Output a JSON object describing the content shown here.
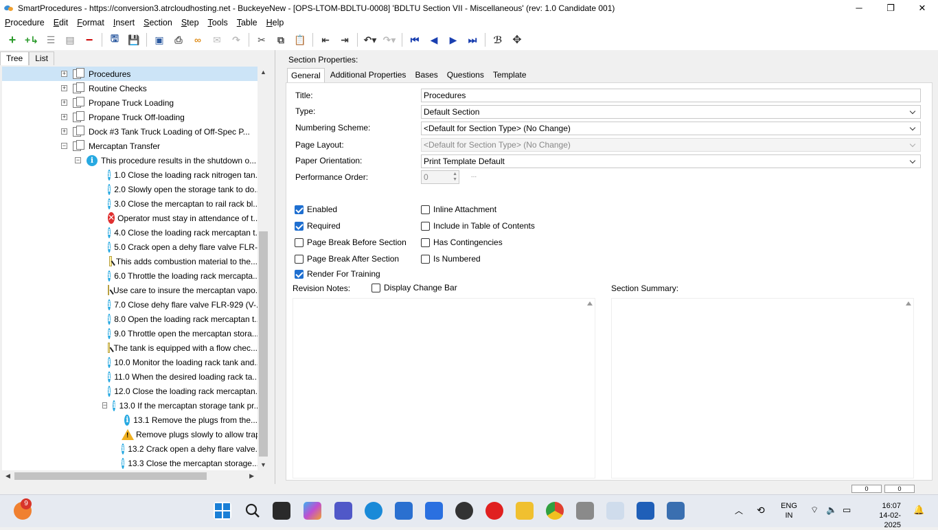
{
  "window": {
    "title": "SmartProcedures - https://conversion3.atrcloudhosting.net - BuckeyeNew - [OPS-LTOM-BDLTU-0008] 'BDLTU Section VII - Miscellaneous' (rev: 1.0 Candidate 001)",
    "minimize": "─",
    "maximize": "❐",
    "close": "✕"
  },
  "menu": [
    "Procedure",
    "Edit",
    "Format",
    "Insert",
    "Section",
    "Step",
    "Tools",
    "Table",
    "Help"
  ],
  "left_tabs": [
    "Tree",
    "List"
  ],
  "tree": [
    {
      "label": "Procedures",
      "type": "doc",
      "expander": "+",
      "level": 0,
      "selected": true
    },
    {
      "label": "Routine Checks",
      "type": "doc",
      "expander": "+",
      "level": 0
    },
    {
      "label": "Propane Truck Loading",
      "type": "doc",
      "expander": "+",
      "level": 0
    },
    {
      "label": "Propane Truck Off-loading",
      "type": "doc",
      "expander": "+",
      "level": 0
    },
    {
      "label": "Dock #3 Tank Truck Loading of Off-Spec P...",
      "type": "doc",
      "expander": "+",
      "level": 0
    },
    {
      "label": "Mercaptan Transfer",
      "type": "doc",
      "expander": "−",
      "level": 0
    },
    {
      "label": "This procedure results in the shutdown o...",
      "type": "info",
      "expander": "−",
      "level": 1
    },
    {
      "label": "1.0 Close the loading rack nitrogen tan...",
      "type": "info",
      "level": 2
    },
    {
      "label": "2.0 Slowly open the storage tank to do...",
      "type": "info",
      "level": 2
    },
    {
      "label": "3.0 Close the mercaptan to rail rack bl...",
      "type": "info",
      "level": 2
    },
    {
      "label": "Operator must stay in attendance of t...",
      "type": "error",
      "level": 2
    },
    {
      "label": "4.0 Close the loading rack mercaptan t...",
      "type": "info",
      "level": 2
    },
    {
      "label": "5.0 Crack open a dehy flare valve FLR-...",
      "type": "info",
      "level": 2
    },
    {
      "label": "This adds combustion material to the...",
      "type": "note",
      "level": 2
    },
    {
      "label": "6.0 Throttle the loading rack mercapta...",
      "type": "info",
      "level": 2
    },
    {
      "label": "Use care to insure the mercaptan vapo...",
      "type": "note",
      "level": 2
    },
    {
      "label": "7.0 Close dehy flare valve FLR-929 (V-...",
      "type": "info",
      "level": 2
    },
    {
      "label": "8.0 Open the loading rack mercaptan t...",
      "type": "info",
      "level": 2
    },
    {
      "label": "9.0 Throttle open the mercaptan stora...",
      "type": "info",
      "level": 2
    },
    {
      "label": "The tank is equipped with a flow chec...",
      "type": "note",
      "level": 2
    },
    {
      "label": "10.0 Monitor the loading rack tank and...",
      "type": "info",
      "level": 2
    },
    {
      "label": "11.0 When the desired loading rack ta...",
      "type": "info",
      "level": 2
    },
    {
      "label": "12.0 Close the loading rack mercaptan...",
      "type": "info",
      "level": 2
    },
    {
      "label": "13.0 If the mercaptan storage tank pr...",
      "type": "info",
      "expander": "−",
      "level": 2
    },
    {
      "label": "13.1 Remove the plugs from the...",
      "type": "info",
      "level": 3
    },
    {
      "label": "Remove plugs slowly to allow trap...",
      "type": "warn",
      "level": 3
    },
    {
      "label": "13.2 Crack open a dehy flare valve...",
      "type": "info",
      "level": 3
    },
    {
      "label": "13.3 Close the mercaptan storage...",
      "type": "info",
      "level": 3
    }
  ],
  "section_properties": {
    "heading": "Section Properties:",
    "tabs": [
      "General",
      "Additional Properties",
      "Bases",
      "Questions",
      "Template"
    ],
    "labels": {
      "title": "Title:",
      "type": "Type:",
      "numbering": "Numbering Scheme:",
      "layout": "Page Layout:",
      "orientation": "Paper Orientation:",
      "performance": "Performance Order:"
    },
    "values": {
      "title": "Procedures",
      "type": "Default Section",
      "numbering": "<Default for Section Type> (No Change)",
      "layout": "<Default for Section Type> (No Change)",
      "orientation": "Print Template Default",
      "performance": "0",
      "performance_extra": "..."
    },
    "checkboxes": {
      "enabled": {
        "label": "Enabled",
        "checked": true
      },
      "required": {
        "label": "Required",
        "checked": true
      },
      "page_break_before": {
        "label": "Page Break Before Section",
        "checked": false
      },
      "page_break_after": {
        "label": "Page Break After Section",
        "checked": false
      },
      "render_training": {
        "label": "Render For Training",
        "checked": true
      },
      "inline_attachment": {
        "label": "Inline Attachment",
        "checked": false
      },
      "include_toc": {
        "label": "Include in Table of Contents",
        "checked": false
      },
      "has_contingencies": {
        "label": "Has Contingencies",
        "checked": false
      },
      "is_numbered": {
        "label": "Is Numbered",
        "checked": false
      },
      "display_change_bar": {
        "label": "Display Change Bar",
        "checked": false
      }
    },
    "revision_notes_label": "Revision Notes:",
    "section_summary_label": "Section Summary:"
  },
  "status": {
    "box1": "0",
    "box2": "0"
  },
  "taskbar": {
    "notification_count": "9",
    "lang_line1": "ENG",
    "lang_line2": "IN",
    "time": "16:07",
    "date": "14-02-2025"
  }
}
